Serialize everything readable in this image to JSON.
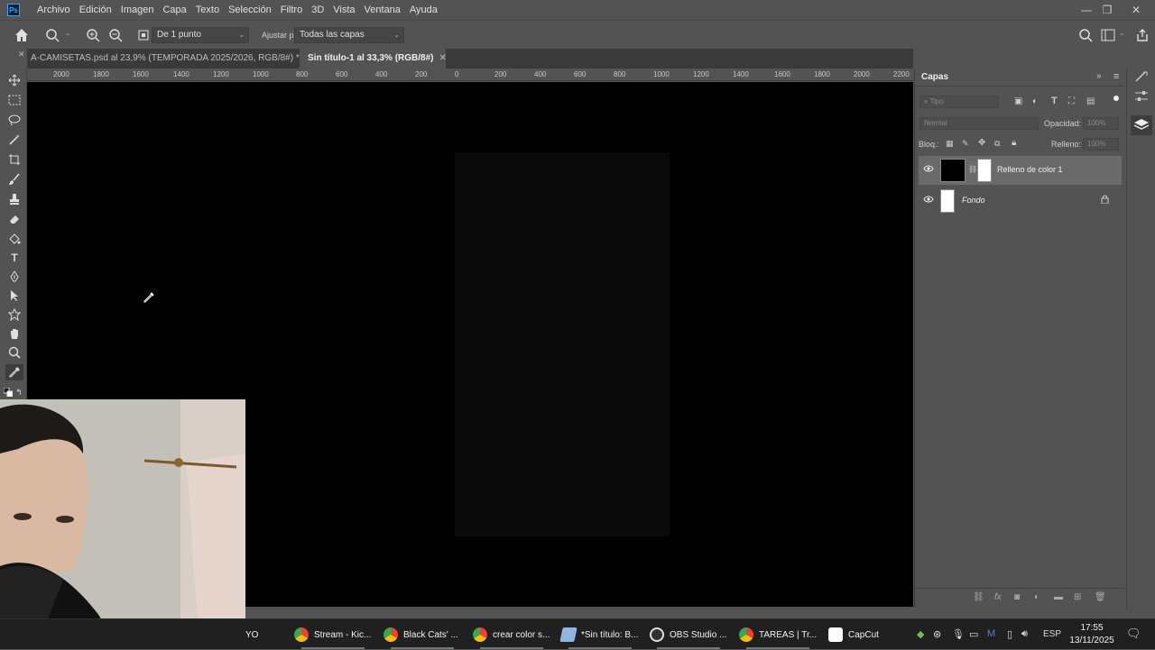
{
  "app": {
    "logo_text": "Ps",
    "menu": [
      "Archivo",
      "Edición",
      "Imagen",
      "Capa",
      "Texto",
      "Selección",
      "Filtro",
      "3D",
      "Vista",
      "Ventana",
      "Ayuda"
    ],
    "window_controls": {
      "minimize": "—",
      "restore": "❐",
      "close": "✕"
    }
  },
  "options_bar": {
    "sample_size": "De 1 punto",
    "sample_label": "Ajustar p",
    "sample_layers": "Todas las capas"
  },
  "doc_tabs": [
    {
      "label": "A-CAMISETAS.psd al 23,9% (TEMPORADA 2025/2026, RGB/8#) *",
      "active": false
    },
    {
      "label": "Sin título-1 al 33,3% (RGB/8#)",
      "active": true
    }
  ],
  "ruler": {
    "labels": [
      "2000",
      "1800",
      "1600",
      "1400",
      "1200",
      "1000",
      "800",
      "600",
      "400",
      "200",
      "0",
      "200",
      "400",
      "600",
      "800",
      "1000",
      "1200",
      "1400",
      "1600",
      "1800",
      "2000",
      "2200"
    ]
  },
  "layers_panel": {
    "title": "Capas",
    "search_placeholder": "Tipo",
    "blend_mode": "Normal",
    "opacity_label": "Opacidad:",
    "opacity_value": "100%",
    "lock_label": "Bloq.:",
    "fill_label": "Relleno:",
    "fill_value": "100%",
    "layers": [
      {
        "name": "Relleno de color 1",
        "visible": true,
        "selected": true
      },
      {
        "name": "Fondo",
        "visible": true,
        "locked": true
      }
    ]
  },
  "taskbar": {
    "items": [
      {
        "label": "YO"
      },
      {
        "label": "Stream - Kic..."
      },
      {
        "label": "Black Cats' ..."
      },
      {
        "label": "crear color s..."
      },
      {
        "label": "*Sin título: B..."
      },
      {
        "label": "OBS Studio ..."
      },
      {
        "label": "TAREAS | Tr..."
      },
      {
        "label": "CapCut"
      }
    ],
    "language": "ESP",
    "time": "17:55",
    "date": "13/11/2025"
  }
}
